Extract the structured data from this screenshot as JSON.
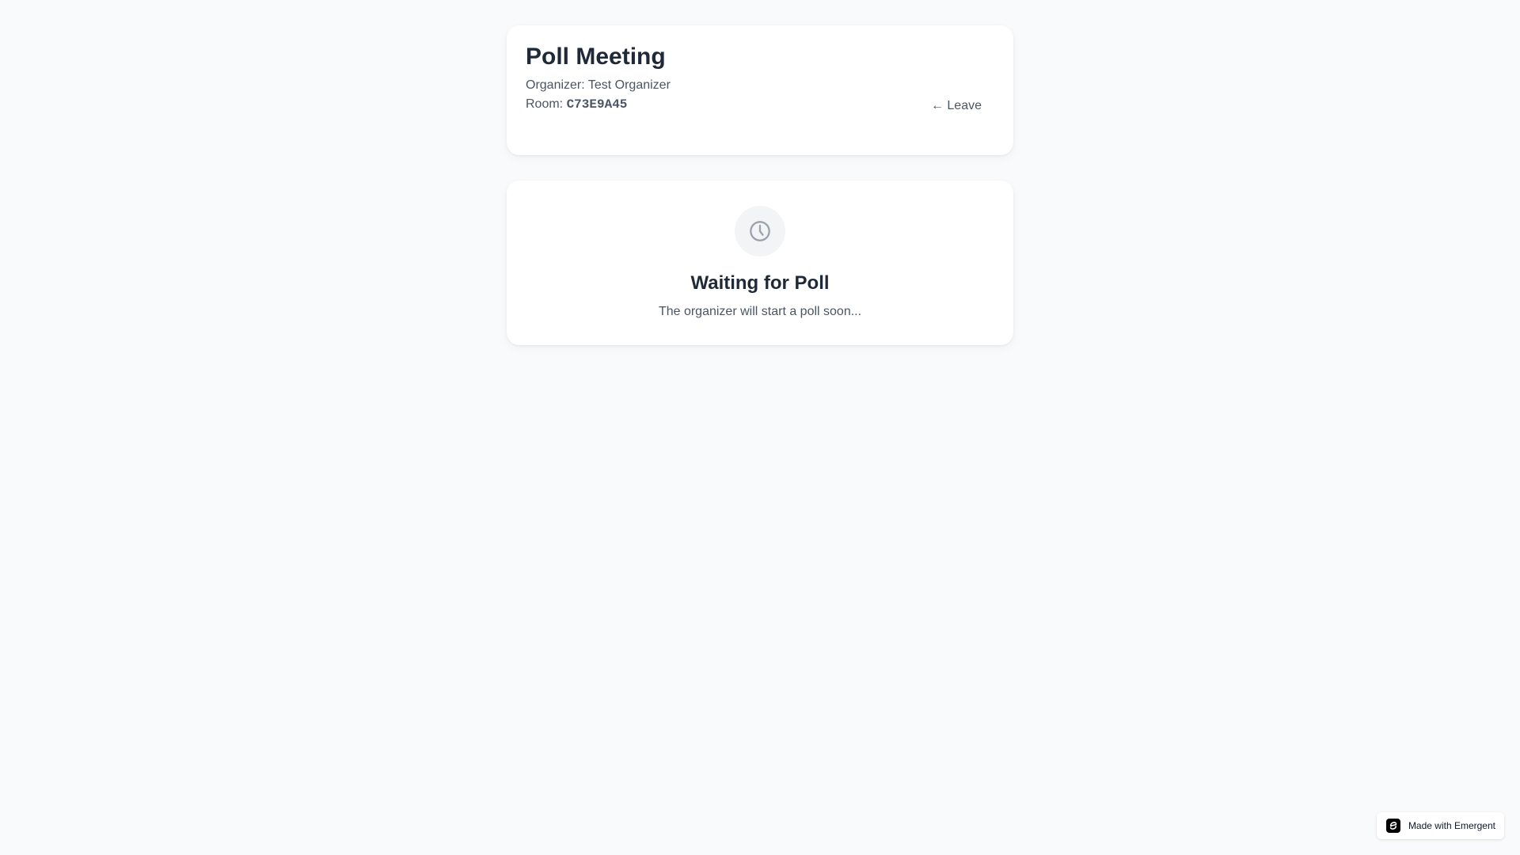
{
  "meeting": {
    "title": "Poll Meeting",
    "organizer_label": "Organizer: ",
    "organizer_name": "Test Organizer",
    "room_label": "Room: ",
    "room_code": "C73E9A45",
    "leave_label": "← Leave"
  },
  "waiting": {
    "icon": "clock-icon",
    "title": "Waiting for Poll",
    "subtitle": "The organizer will start a poll soon..."
  },
  "badge": {
    "icon": "emergent-logo-icon",
    "label": "Made with Emergent"
  },
  "colors": {
    "background": "#f9fafb",
    "card": "#ffffff",
    "heading": "#1f2937",
    "muted_text": "#4b5563",
    "icon_circle": "#f3f4f6",
    "icon_stroke": "#9ca3af"
  }
}
